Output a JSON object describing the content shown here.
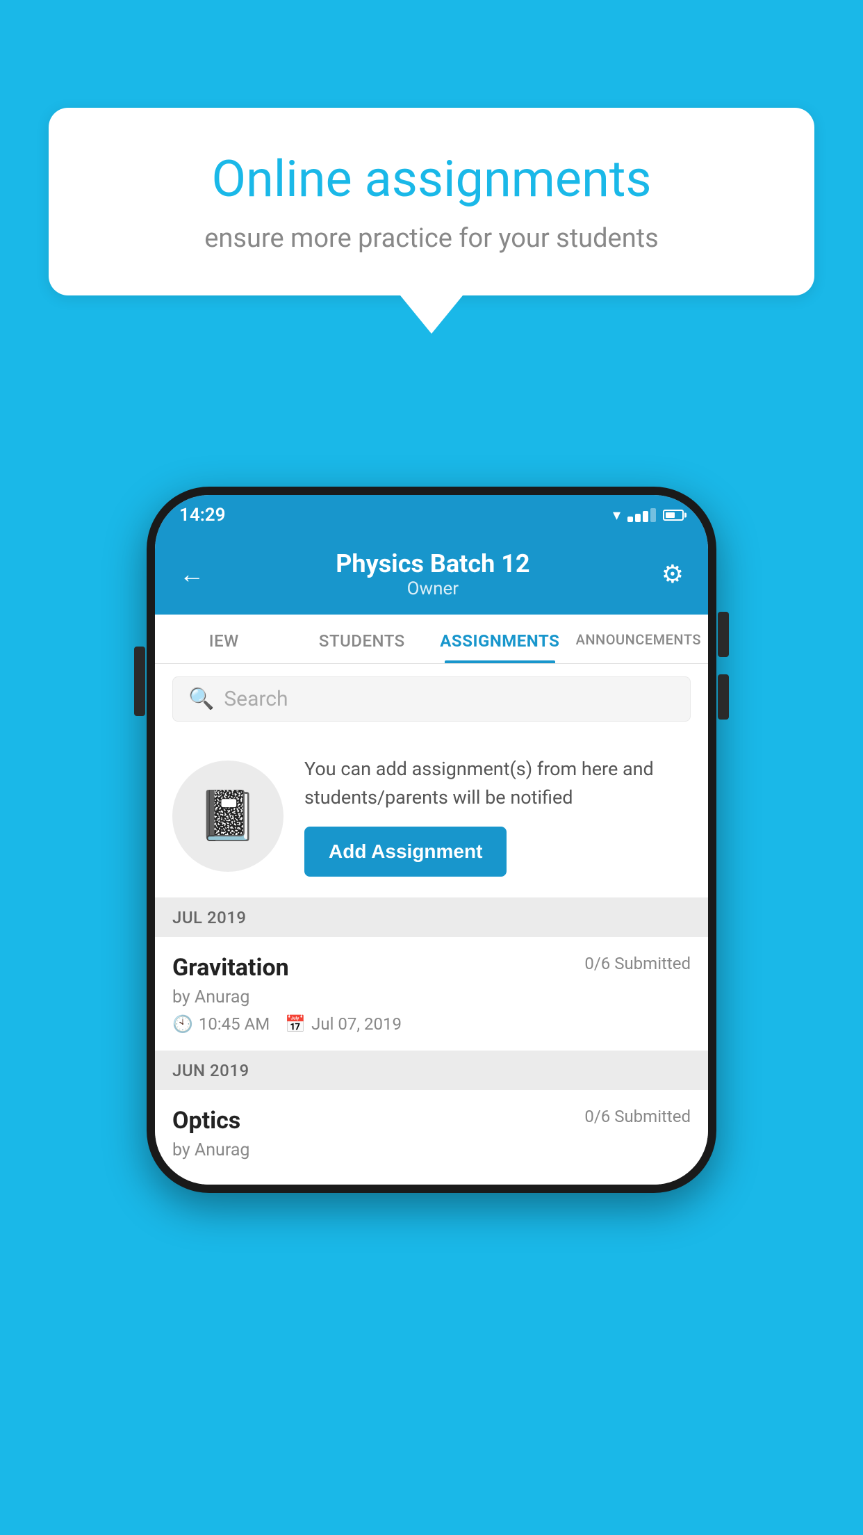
{
  "background_color": "#1ab8e8",
  "speech_bubble": {
    "title": "Online assignments",
    "subtitle": "ensure more practice for your students"
  },
  "status_bar": {
    "time": "14:29"
  },
  "header": {
    "title": "Physics Batch 12",
    "subtitle": "Owner",
    "back_label": "←",
    "settings_label": "⚙"
  },
  "tabs": [
    {
      "label": "IEW",
      "active": false
    },
    {
      "label": "STUDENTS",
      "active": false
    },
    {
      "label": "ASSIGNMENTS",
      "active": true
    },
    {
      "label": "ANNOUNCEMENTS",
      "active": false
    }
  ],
  "search": {
    "placeholder": "Search"
  },
  "info_card": {
    "description": "You can add assignment(s) from here and students/parents will be notified",
    "button_label": "Add Assignment"
  },
  "sections": [
    {
      "month": "JUL 2019",
      "assignments": [
        {
          "title": "Gravitation",
          "submitted": "0/6 Submitted",
          "author": "by Anurag",
          "time": "10:45 AM",
          "date": "Jul 07, 2019"
        }
      ]
    },
    {
      "month": "JUN 2019",
      "assignments": [
        {
          "title": "Optics",
          "submitted": "0/6 Submitted",
          "author": "by Anurag",
          "time": "",
          "date": ""
        }
      ]
    }
  ]
}
